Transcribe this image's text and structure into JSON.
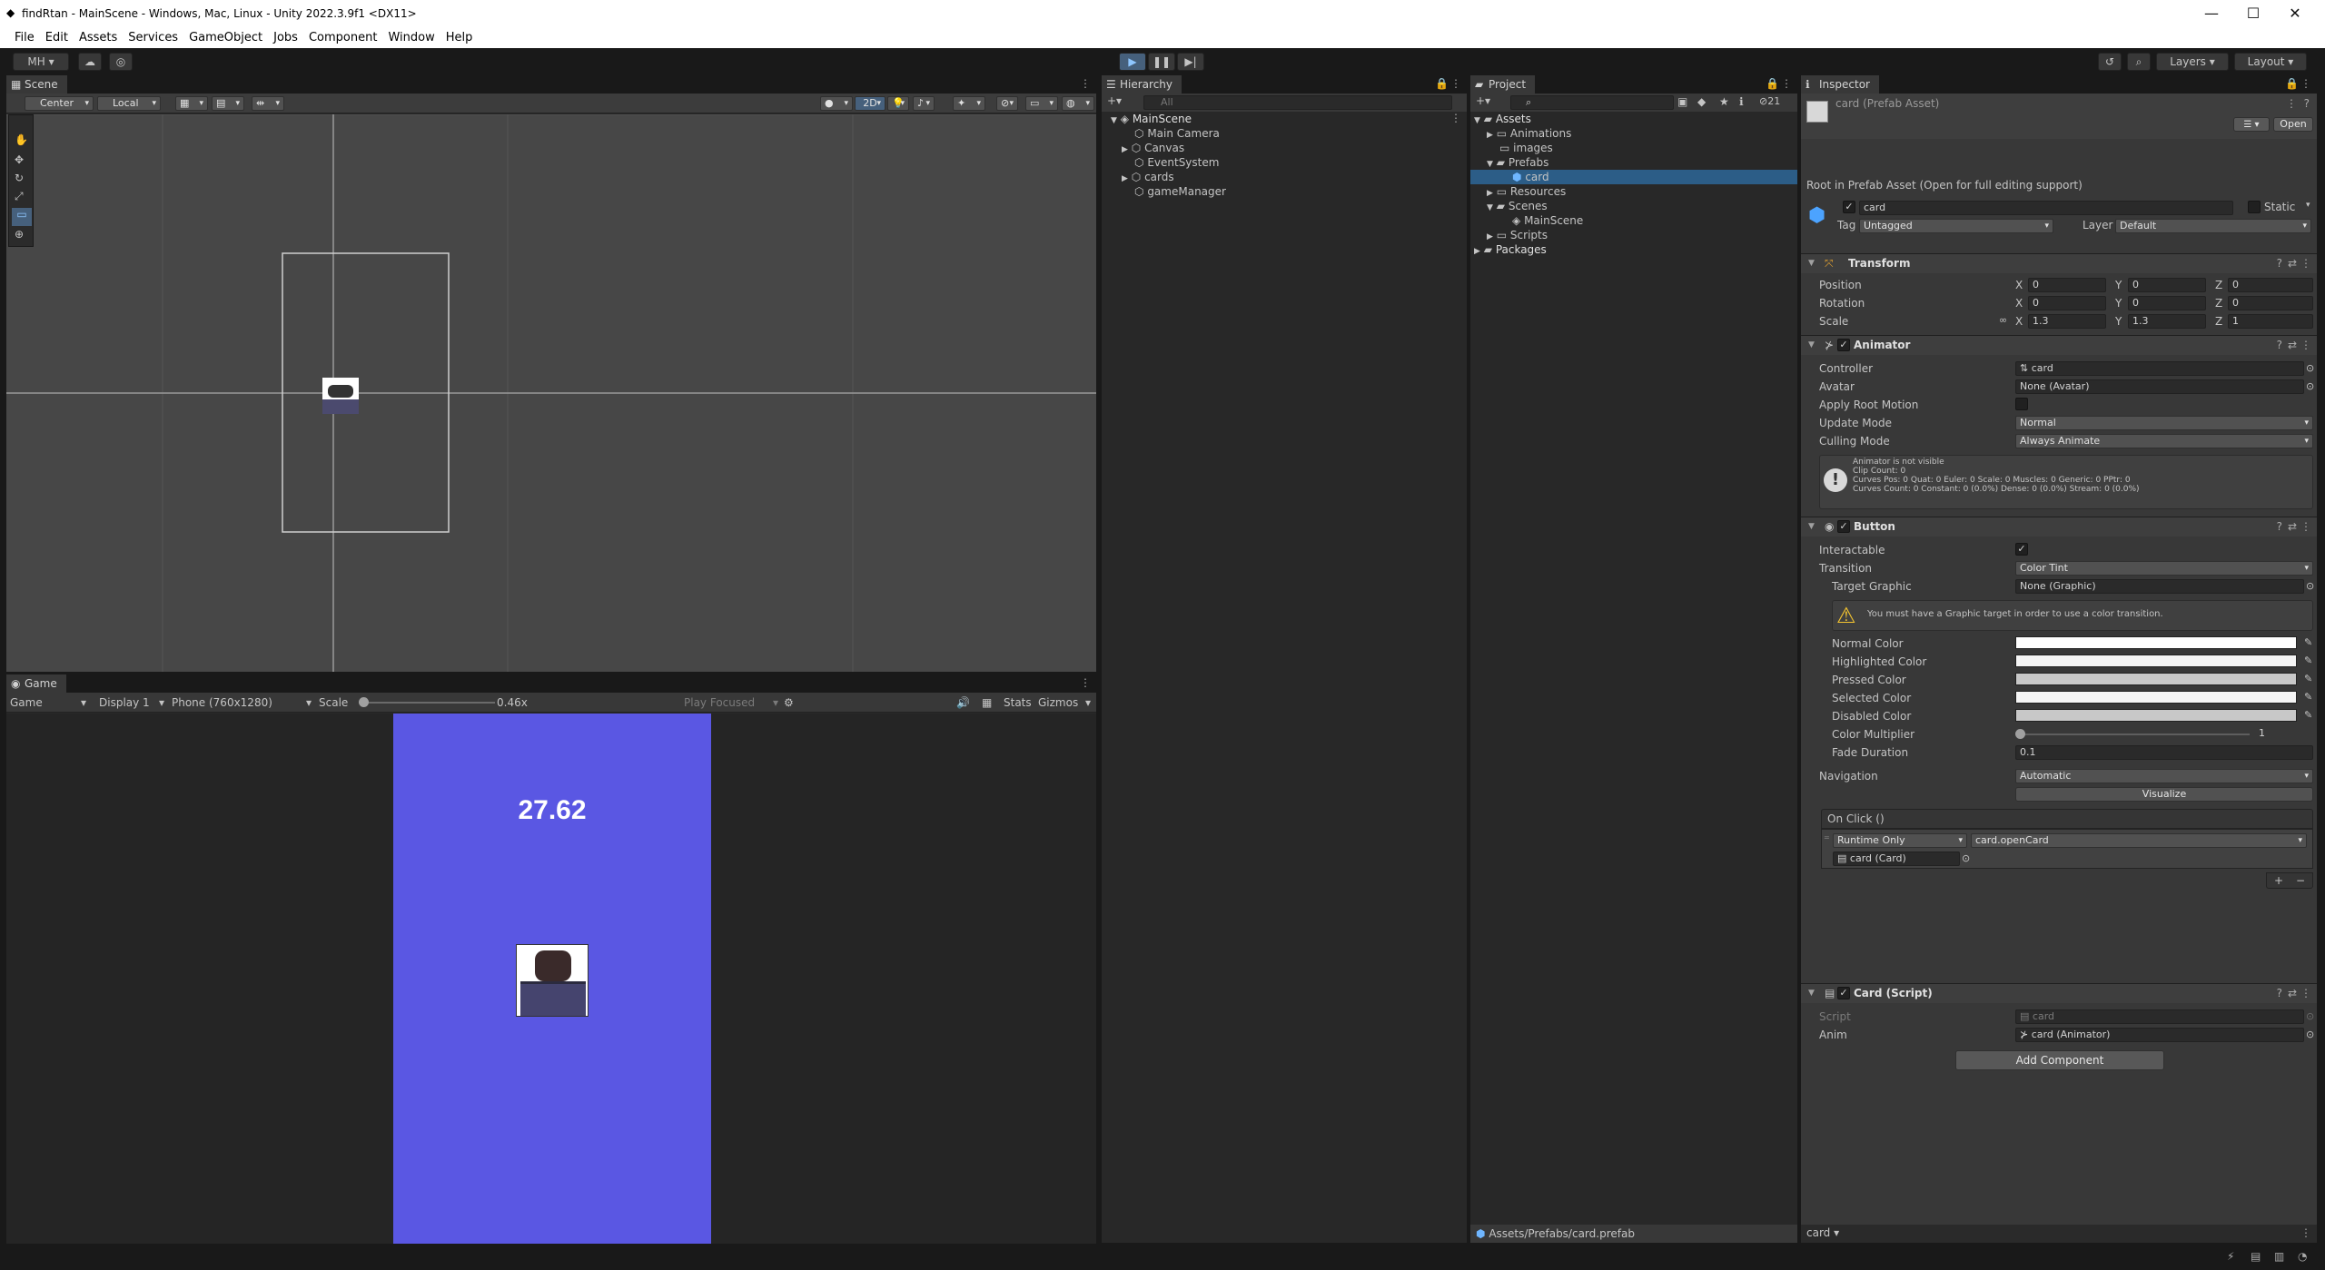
{
  "window": {
    "title": "findRtan - MainScene - Windows, Mac, Linux - Unity 2022.3.9f1 <DX11>",
    "minimize": "—",
    "maximize": "☐",
    "close": "✕"
  },
  "menu": [
    "File",
    "Edit",
    "Assets",
    "Services",
    "GameObject",
    "Jobs",
    "Component",
    "Window",
    "Help"
  ],
  "toolbar": {
    "account": "MH",
    "layers": "Layers",
    "layout": "Layout"
  },
  "scene": {
    "tab": "Scene",
    "pivot_mode": "Center",
    "space_mode": "Local",
    "mode_2d": "2D"
  },
  "game": {
    "tab": "Game",
    "view_select": "Game",
    "display": "Display 1",
    "resolution": "Phone (760x1280)",
    "scale_label": "Scale",
    "scale_value": "0.46x",
    "play_focused": "Play Focused",
    "stats": "Stats",
    "gizmos": "Gizmos",
    "timer": "27.62",
    "bg_color": "#5a57e3"
  },
  "hierarchy": {
    "tab": "Hierarchy",
    "search_placeholder": "All",
    "scene": "MainScene",
    "items": [
      "Main Camera",
      "Canvas",
      "EventSystem",
      "cards",
      "gameManager"
    ]
  },
  "project": {
    "tab": "Project",
    "badge": "21",
    "tree": {
      "assets": "Assets",
      "animations": "Animations",
      "images": "images",
      "prefabs": "Prefabs",
      "card": "card",
      "resources": "Resources",
      "scenes": "Scenes",
      "mainscene": "MainScene",
      "scripts": "Scripts",
      "packages": "Packages"
    },
    "footer_path": "Assets/Prefabs/card.prefab"
  },
  "inspector": {
    "tab": "Inspector",
    "asset_title": "card (Prefab Asset)",
    "open_button": "Open",
    "root_note": "Root in Prefab Asset (Open for full editing support)",
    "name": "card",
    "static_label": "Static",
    "tag_label": "Tag",
    "tag_value": "Untagged",
    "layer_label": "Layer",
    "layer_value": "Default",
    "transform": {
      "name": "Transform",
      "position_label": "Position",
      "rotation_label": "Rotation",
      "scale_label": "Scale",
      "position": [
        "0",
        "0",
        "0"
      ],
      "rotation": [
        "0",
        "0",
        "0"
      ],
      "scale": [
        "1.3",
        "1.3",
        "1"
      ]
    },
    "animator": {
      "name": "Animator",
      "controller_label": "Controller",
      "controller_value": "card",
      "avatar_label": "Avatar",
      "avatar_value": "None (Avatar)",
      "root_motion_label": "Apply Root Motion",
      "update_mode_label": "Update Mode",
      "update_mode_value": "Normal",
      "culling_mode_label": "Culling Mode",
      "culling_mode_value": "Always Animate",
      "info_1": "Animator is not visible",
      "info_2": "Clip Count: 0",
      "info_3": "Curves Pos: 0 Quat: 0 Euler: 0 Scale: 0 Muscles: 0 Generic: 0 PPtr: 0",
      "info_4": "Curves Count: 0 Constant: 0 (0.0%) Dense: 0 (0.0%) Stream: 0 (0.0%)"
    },
    "button": {
      "name": "Button",
      "interactable_label": "Interactable",
      "transition_label": "Transition",
      "transition_value": "Color Tint",
      "target_graphic_label": "Target Graphic",
      "target_graphic_value": "None (Graphic)",
      "warning": "You must have a Graphic target in order to use a color transition.",
      "normal_color_label": "Normal Color",
      "highlighted_color_label": "Highlighted Color",
      "pressed_color_label": "Pressed Color",
      "selected_color_label": "Selected Color",
      "disabled_color_label": "Disabled Color",
      "color_multiplier_label": "Color Multiplier",
      "color_multiplier_value": "1",
      "fade_duration_label": "Fade Duration",
      "fade_duration_value": "0.1",
      "navigation_label": "Navigation",
      "navigation_value": "Automatic",
      "visualize": "Visualize",
      "onclick_label": "On Click ()",
      "runtime_value": "Runtime Only",
      "function_value": "card.openCard",
      "object_value": "card (Card)",
      "add": "+",
      "remove": "−",
      "colors": {
        "normal": "#ffffff",
        "highlighted": "#f5f5f5",
        "pressed": "#c8c8c8",
        "selected": "#f5f5f5",
        "disabled": "#c8c8c8"
      }
    },
    "card_script": {
      "name": "Card (Script)",
      "script_label": "Script",
      "script_value": "card",
      "anim_label": "Anim",
      "anim_value": "card (Animator)"
    },
    "add_component": "Add Component",
    "footer": "card"
  }
}
